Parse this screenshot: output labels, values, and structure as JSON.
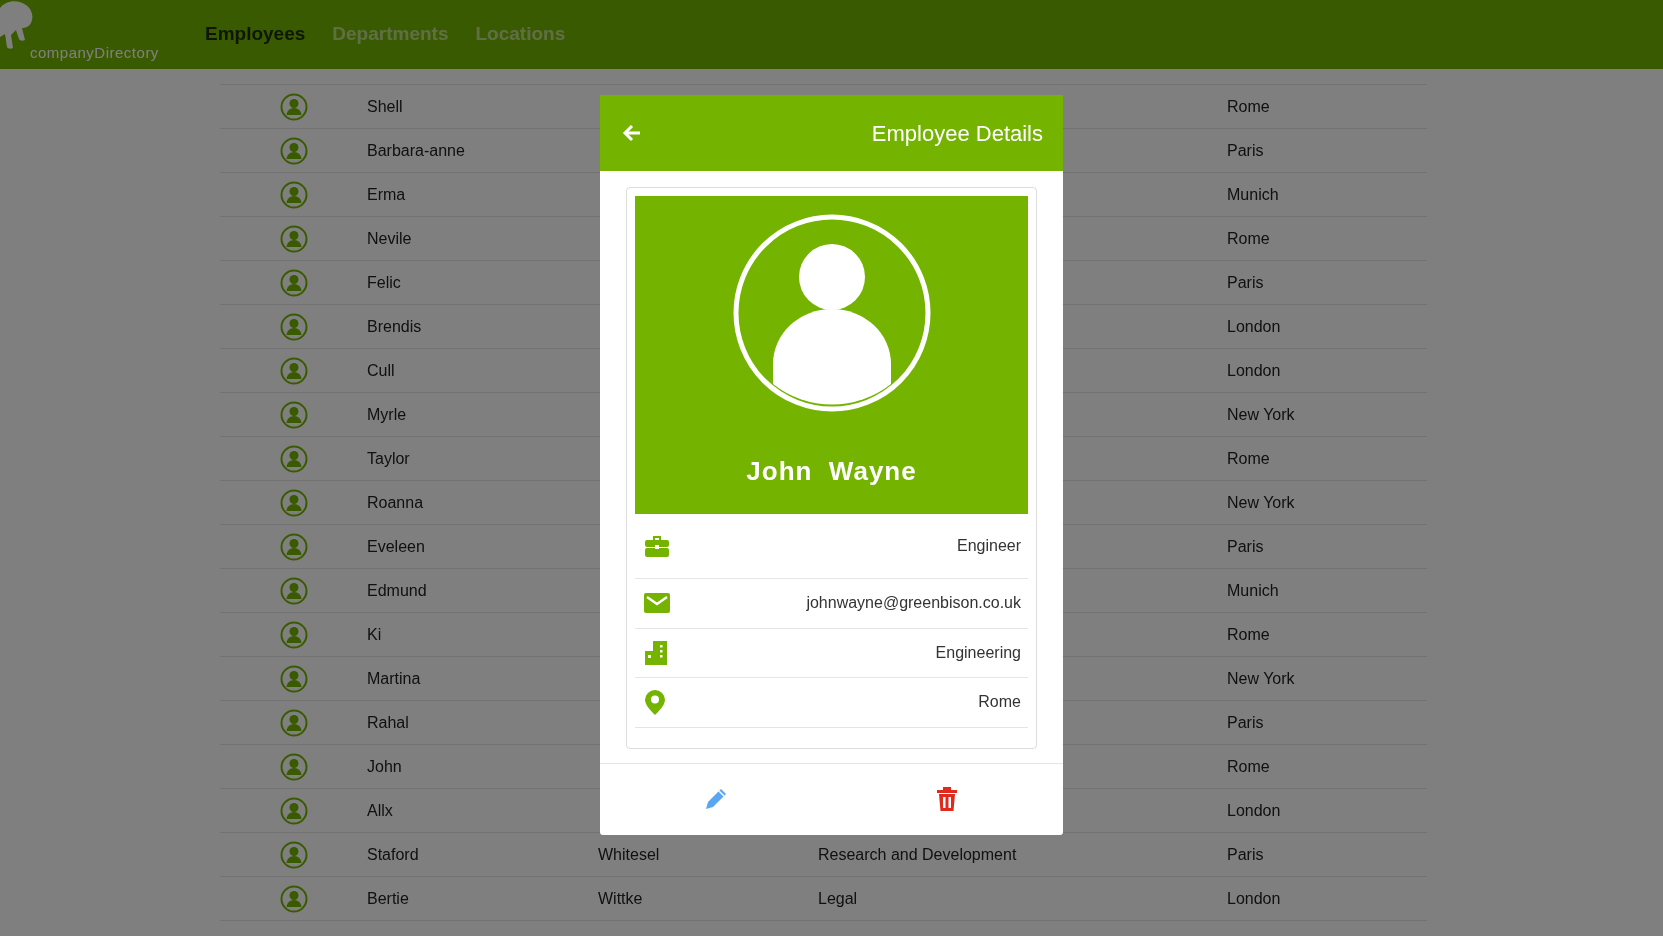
{
  "navbar": {
    "brand": "companyDirectory",
    "links": [
      {
        "label": "Employees",
        "selected": true
      },
      {
        "label": "Departments",
        "selected": false
      },
      {
        "label": "Locations",
        "selected": false
      }
    ]
  },
  "employees": [
    {
      "first_name": "Shell",
      "location": "Rome"
    },
    {
      "first_name": "Barbara-anne",
      "location": "Paris"
    },
    {
      "first_name": "Erma",
      "location": "Munich"
    },
    {
      "first_name": "Nevile",
      "location": "Rome"
    },
    {
      "first_name": "Felic",
      "location": "Paris"
    },
    {
      "first_name": "Brendis",
      "location": "London"
    },
    {
      "first_name": "Cull",
      "location": "London"
    },
    {
      "first_name": "Myrle",
      "location": "New York"
    },
    {
      "first_name": "Taylor",
      "location": "Rome"
    },
    {
      "first_name": "Roanna",
      "location": "New York"
    },
    {
      "first_name": "Eveleen",
      "location": "Paris"
    },
    {
      "first_name": "Edmund",
      "location": "Munich"
    },
    {
      "first_name": "Ki",
      "location": "Rome"
    },
    {
      "first_name": "Martina",
      "location": "New York"
    },
    {
      "first_name": "Rahal",
      "location": "Paris"
    },
    {
      "first_name": "John",
      "location": "Rome"
    },
    {
      "first_name": "Allx",
      "location": "London"
    },
    {
      "first_name": "Staford",
      "last_name": "Whitesel",
      "department": "Research and Development",
      "location": "Paris"
    },
    {
      "first_name": "Bertie",
      "last_name": "Wittke",
      "department": "Legal",
      "location": "London"
    }
  ],
  "modal": {
    "title": "Employee Details",
    "name": "John  Wayne",
    "details": [
      {
        "kind": "job",
        "value": "Engineer"
      },
      {
        "kind": "email",
        "value": "johnwayne@greenbison.co.uk"
      },
      {
        "kind": "department",
        "value": "Engineering"
      },
      {
        "kind": "location",
        "value": "Rome"
      }
    ]
  }
}
